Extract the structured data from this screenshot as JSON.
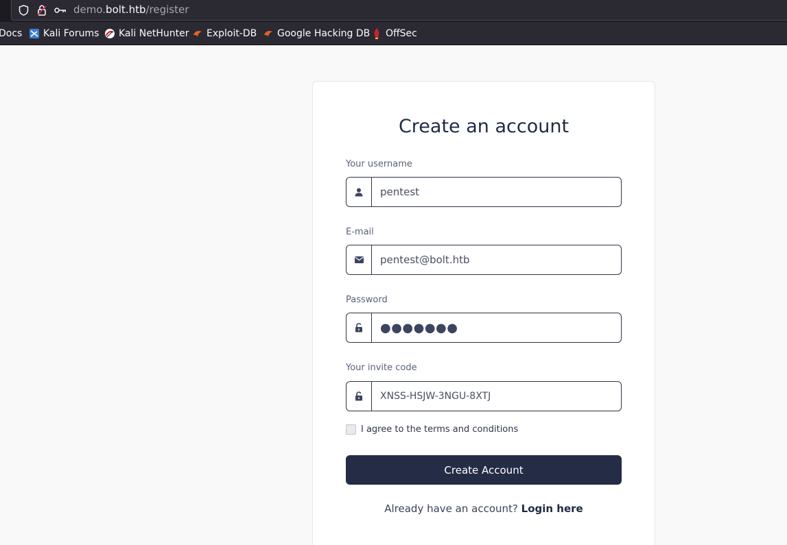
{
  "browser": {
    "url_prefix": "demo.",
    "url_domain": "bolt.htb",
    "url_path": "/register",
    "bookmarks": [
      {
        "label": "Docs",
        "icon": "docs-icon"
      },
      {
        "label": "Kali Forums",
        "icon": "kali-forums-icon"
      },
      {
        "label": "Kali NetHunter",
        "icon": "kali-nethunter-icon"
      },
      {
        "label": "Exploit-DB",
        "icon": "exploit-db-icon"
      },
      {
        "label": "Google Hacking DB",
        "icon": "ghdb-icon"
      },
      {
        "label": "OffSec",
        "icon": "offsec-icon"
      }
    ]
  },
  "form": {
    "title": "Create an account",
    "username": {
      "label": "Your username",
      "value": "pentest",
      "icon": "user-icon"
    },
    "email": {
      "label": "E-mail",
      "value": "pentest@bolt.htb",
      "icon": "envelope-icon"
    },
    "password": {
      "label": "Password",
      "value": "●●●●●●●",
      "icon": "unlock-icon"
    },
    "invite": {
      "label": "Your invite code",
      "value": "XNSS-HSJW-3NGU-8XTJ",
      "icon": "unlock-icon"
    },
    "terms_label": "I agree to the terms and conditions",
    "submit_label": "Create Account",
    "login_prompt": "Already have an account?",
    "login_link": "Login here"
  },
  "colors": {
    "primary": "#242c46",
    "browser_chrome": "#2b2a33",
    "page_bg": "#f9f9fa"
  }
}
